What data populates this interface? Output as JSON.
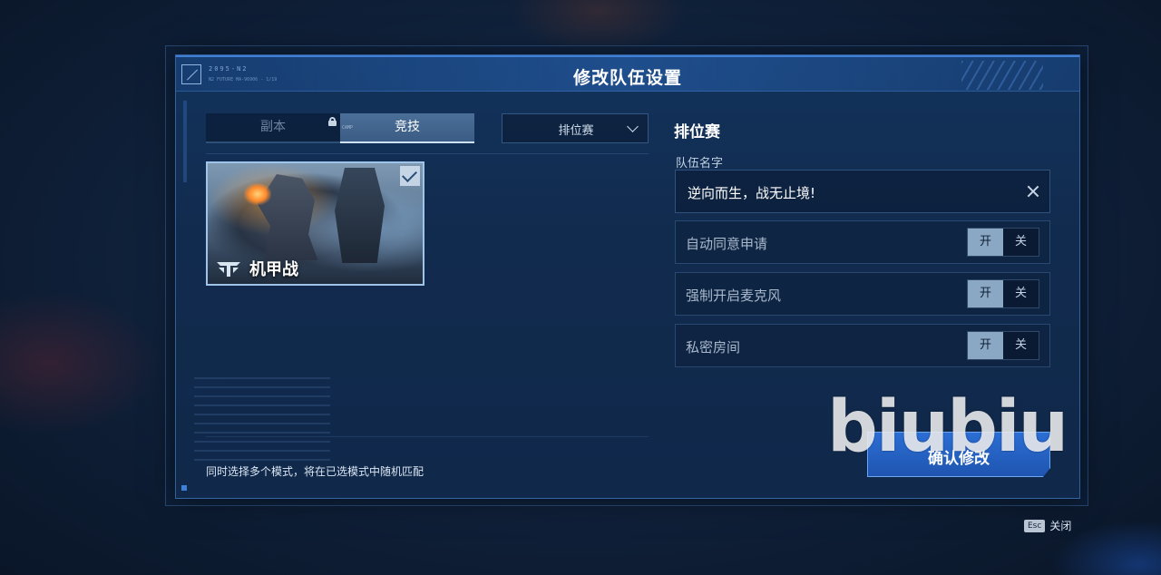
{
  "dialog": {
    "title": "修改队伍设置",
    "corner_tag": "2095-N2",
    "corner_subtag": "N2 FUTURE MA-96906 - 1/19"
  },
  "tabs": [
    {
      "label": "副本",
      "locked": true,
      "active": false
    },
    {
      "label": "竞技",
      "tag": "CAMP",
      "active": true
    }
  ],
  "mode_select": {
    "value": "排位赛"
  },
  "mode_card": {
    "label": "机甲战",
    "selected": true
  },
  "hint": "同时选择多个模式，将在已选模式中随机匹配",
  "settings_panel": {
    "title": "排位赛",
    "team_name_label": "队伍名字",
    "team_name_value": "逆向而生，战无止境!",
    "rows": [
      {
        "label": "自动同意申请",
        "on_label": "开",
        "off_label": "关",
        "state": "on"
      },
      {
        "label": "强制开启麦克风",
        "on_label": "开",
        "off_label": "关",
        "state": "on"
      },
      {
        "label": "私密房间",
        "on_label": "开",
        "off_label": "关",
        "state": "on"
      }
    ]
  },
  "confirm_button": "确认修改",
  "watermark": "biubiu",
  "footer": {
    "key": "Esc",
    "label": "关闭"
  },
  "colors": {
    "accent": "#2b6ed4",
    "toggle_on": "#8aa7c4",
    "panel_bg": "#13335c"
  }
}
